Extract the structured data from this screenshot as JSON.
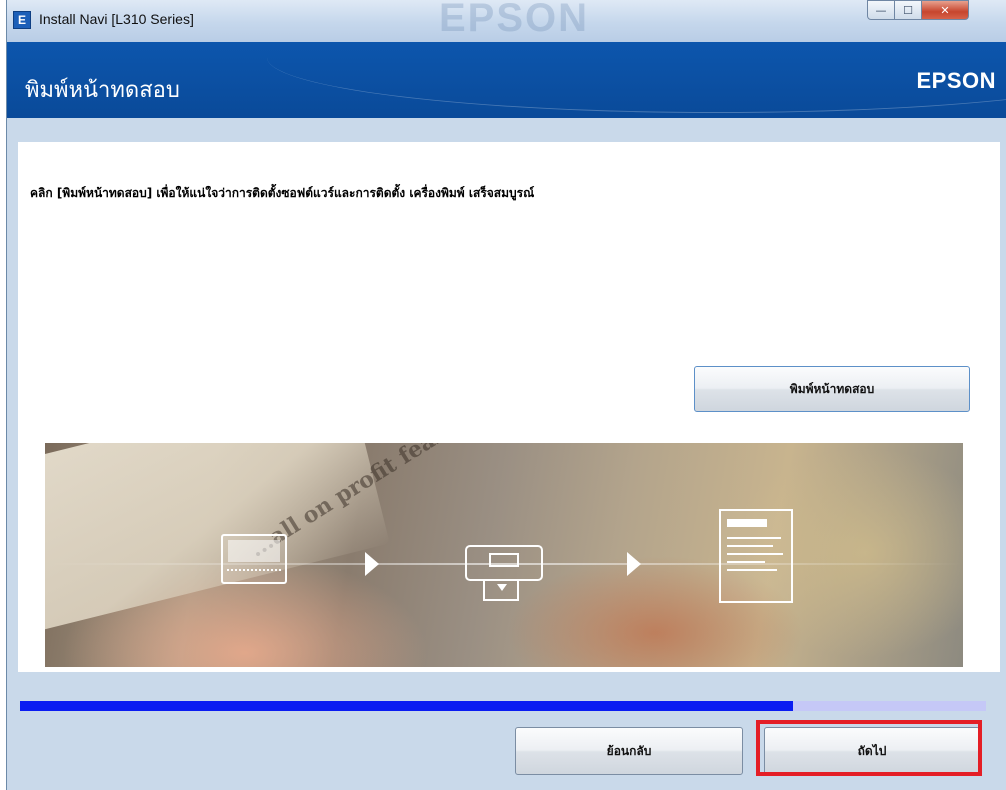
{
  "window": {
    "title": "Install Navi [L310 Series]",
    "icon_letter": "E",
    "watermark": "EPSON",
    "controls": {
      "minimize": "—",
      "maximize": "☐",
      "close": "✕"
    }
  },
  "header": {
    "page_title": "พิมพ์หน้าทดสอบ",
    "brand": "EPSON"
  },
  "main": {
    "instruction": "คลิก [พิมพ์หน้าทดสอบ] เพื่อให้แน่ใจว่าการติดตั้งซอฟต์แวร์และการติดตั้ง เครื่องพิมพ์ เสร็จสมบูรณ์",
    "print_test_button": "พิมพ์หน้าทดสอบ",
    "banner_headline": "...all on profit fear"
  },
  "progress": {
    "value": 0.8
  },
  "footer": {
    "back_button": "ย้อนกลับ",
    "next_button": "ถัดไป"
  },
  "colors": {
    "header_blue": "#0d56ad",
    "progress_fill": "#0a1cf2",
    "progress_track": "#c5c8f7",
    "highlight": "#e41e26"
  },
  "icons": [
    "app-icon",
    "computer-icon",
    "printer-icon",
    "printed-page-icon",
    "arrow-right-icon"
  ]
}
